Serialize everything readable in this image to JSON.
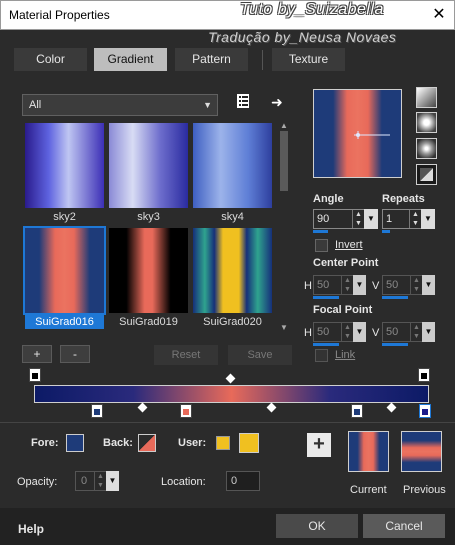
{
  "window": {
    "title": "Material Properties",
    "watermark_line1": "Tuto by_Suizabella",
    "watermark_line2": "Tradução by_Neusa Novaes",
    "close_glyph": "✕"
  },
  "tabs": [
    {
      "label": "Color",
      "active": false
    },
    {
      "label": "Gradient",
      "active": true
    },
    {
      "label": "Pattern",
      "active": false
    },
    {
      "label": "Texture",
      "active": false
    }
  ],
  "gallery": {
    "category": "All",
    "items": [
      {
        "name": "sky2",
        "colors": [
          "#2a1b8c",
          "#5e63e0",
          "#bfc6f2",
          "#3c2fb6"
        ]
      },
      {
        "name": "sky3",
        "colors": [
          "#8a8ad6",
          "#d8dcf4",
          "#6d6dcc",
          "#2a2ba0"
        ]
      },
      {
        "name": "sky4",
        "colors": [
          "#3e5fc2",
          "#9cb3ea",
          "#5e7ed6",
          "#2e3f9e"
        ]
      },
      {
        "name": "SuiGrad016",
        "colors": [
          "#1e3b79",
          "#e86a5a",
          "#1e3b79"
        ],
        "selected": true
      },
      {
        "name": "SuiGrad019",
        "colors": [
          "#000000",
          "#e86a5a",
          "#000000"
        ]
      },
      {
        "name": "SuiGrad020",
        "colors": [
          "#16307a",
          "#2fa38e",
          "#f0c020",
          "#2fa38e",
          "#16307a"
        ]
      }
    ]
  },
  "gallery_buttons": {
    "add": "+",
    "remove": "-",
    "reset": "Reset",
    "save": "Save"
  },
  "settings": {
    "angle_label": "Angle",
    "angle_value": "90",
    "repeats_label": "Repeats",
    "repeats_value": "1",
    "invert_label": "Invert",
    "invert_checked": false,
    "center_point_label": "Center Point",
    "center_h": "50",
    "center_v": "50",
    "focal_point_label": "Focal Point",
    "focal_h": "50",
    "focal_v": "50",
    "link_label": "Link",
    "link_checked": false,
    "h_label": "H",
    "v_label": "V"
  },
  "colors": {
    "fore_label": "Fore:",
    "back_label": "Back:",
    "user_label": "User:",
    "fore_color": "#1e3b79",
    "back_color": "#e86a5a",
    "user_color": "#f0c020",
    "accent": "#1e78d6"
  },
  "editor": {
    "opacity_label": "Opacity:",
    "opacity_value": "0",
    "location_label": "Location:",
    "location_value": "0"
  },
  "preview_swatches": {
    "add_glyph": "+",
    "current_label": "Current",
    "previous_label": "Previous"
  },
  "footer": {
    "help": "Help",
    "ok": "OK",
    "cancel": "Cancel"
  }
}
